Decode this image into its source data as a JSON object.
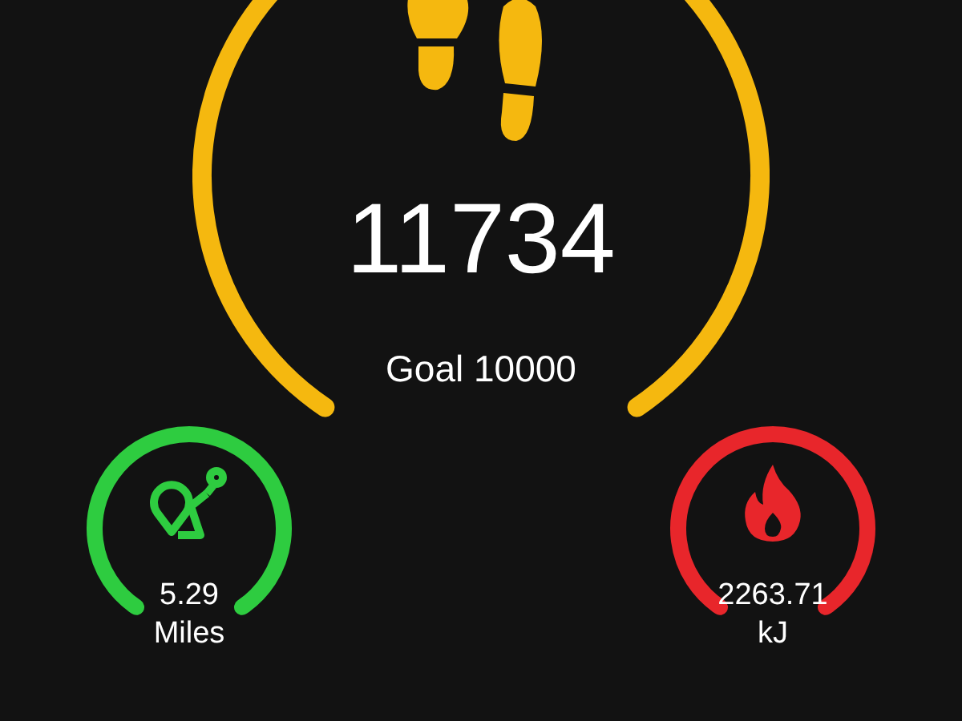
{
  "steps": {
    "count": "11734",
    "goal": "Goal 10000"
  },
  "stats": [
    {
      "kind": "distance",
      "value": "5.29",
      "unit": "Miles",
      "color": "#2ecc40"
    },
    {
      "kind": "energy",
      "value": "2263.71",
      "unit": "kJ",
      "color": "#e8262b"
    }
  ]
}
